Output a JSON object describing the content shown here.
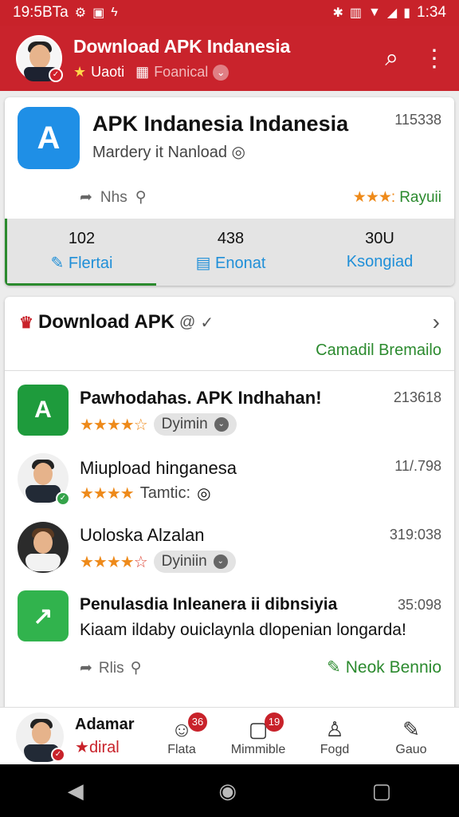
{
  "status_bar": {
    "time_left": "19:5BTa",
    "time_right": "1:34"
  },
  "header": {
    "title": "Download APK Indanesia",
    "sub_left": "Uaoti",
    "sub_right": "Foanical"
  },
  "featured": {
    "title": "APK Indanesia Indanesia",
    "count": "115338",
    "subtitle": "Mardery it Nanload",
    "meta_label": "Nhs",
    "rating_label": "Rayuii",
    "stats": [
      {
        "value": "102",
        "label": "Flertai"
      },
      {
        "value": "438",
        "label": "Enonat"
      },
      {
        "value": "30U",
        "label": "Ksongiad"
      }
    ]
  },
  "section": {
    "title": "Download APK",
    "link": "Camadil Bremailo",
    "items": [
      {
        "title": "Pawhodahas. APK Indhahan!",
        "number": "213618",
        "tag": "Dyimin"
      },
      {
        "title": "Miupload hinganesa",
        "number": "11/.798",
        "tag": "Tamtic:"
      },
      {
        "title": "Uoloska Alzalan",
        "number": "319:038",
        "tag": "Dyiniin"
      },
      {
        "title": "Penulasdia Inleanera ii dibnsiyia",
        "number": "35:098",
        "desc": "Kiaam ildaby ouiclaynla dlopenian longarda!",
        "meta_label": "Rlis",
        "right_label": "Neok Bennio"
      }
    ]
  },
  "bottom_nav": {
    "user_name": "Adamar",
    "user_role": "diral",
    "items": [
      {
        "label": "Flata",
        "icon": "chat-icon",
        "count": "36"
      },
      {
        "label": "Mimmible",
        "icon": "document-icon",
        "count": "19"
      },
      {
        "label": "Fogd",
        "icon": "person-icon"
      },
      {
        "label": "Gauo",
        "icon": "edit-icon"
      }
    ]
  },
  "colors": {
    "brand_red": "#c9232c",
    "accent_green": "#2b8a2e",
    "accent_blue": "#1f8fd8",
    "star": "#ee8a1a"
  }
}
